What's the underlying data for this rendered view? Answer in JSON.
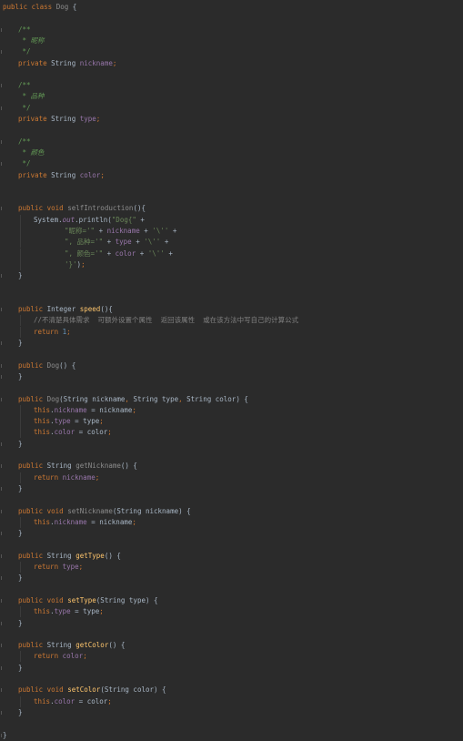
{
  "editor": {
    "language": "Java",
    "colors": {
      "background": "#2b2b2b",
      "keyword": "#cc7832",
      "plain": "#a9b7c6",
      "field": "#9876aa",
      "method": "#ffc66d",
      "string": "#6a8759",
      "number": "#6897bb",
      "doc": "#629755",
      "comment": "#808080",
      "unused": "#8c8c8c"
    },
    "lines": [
      {
        "row": 0,
        "indent": 0,
        "fold": false,
        "tokens": [
          [
            "kw",
            "public class "
          ],
          [
            "unused",
            "Dog "
          ],
          [
            "plain",
            "{"
          ]
        ]
      },
      {
        "row": 2,
        "indent": 1,
        "fold": true,
        "tokens": [
          [
            "doc",
            "/**"
          ]
        ]
      },
      {
        "row": 3,
        "indent": 1,
        "fold": false,
        "tokens": [
          [
            "doc",
            " * "
          ],
          [
            "doc-text",
            "昵称"
          ]
        ]
      },
      {
        "row": 4,
        "indent": 1,
        "fold": true,
        "tokens": [
          [
            "doc",
            " */"
          ]
        ]
      },
      {
        "row": 5,
        "indent": 1,
        "fold": false,
        "tokens": [
          [
            "kw",
            "private "
          ],
          [
            "plain",
            "String "
          ],
          [
            "field",
            "nickname"
          ],
          [
            "kw",
            ";"
          ]
        ]
      },
      {
        "row": 7,
        "indent": 1,
        "fold": true,
        "tokens": [
          [
            "doc",
            "/**"
          ]
        ]
      },
      {
        "row": 8,
        "indent": 1,
        "fold": false,
        "tokens": [
          [
            "doc",
            " * "
          ],
          [
            "doc-text",
            "品种"
          ]
        ]
      },
      {
        "row": 9,
        "indent": 1,
        "fold": true,
        "tokens": [
          [
            "doc",
            " */"
          ]
        ]
      },
      {
        "row": 10,
        "indent": 1,
        "fold": false,
        "tokens": [
          [
            "kw",
            "private "
          ],
          [
            "plain",
            "String "
          ],
          [
            "field",
            "type"
          ],
          [
            "kw",
            ";"
          ]
        ]
      },
      {
        "row": 12,
        "indent": 1,
        "fold": true,
        "tokens": [
          [
            "doc",
            "/**"
          ]
        ]
      },
      {
        "row": 13,
        "indent": 1,
        "fold": false,
        "tokens": [
          [
            "doc",
            " * "
          ],
          [
            "doc-text",
            "颜色"
          ]
        ]
      },
      {
        "row": 14,
        "indent": 1,
        "fold": true,
        "tokens": [
          [
            "doc",
            " */"
          ]
        ]
      },
      {
        "row": 15,
        "indent": 1,
        "fold": false,
        "tokens": [
          [
            "kw",
            "private "
          ],
          [
            "plain",
            "String "
          ],
          [
            "field",
            "color"
          ],
          [
            "kw",
            ";"
          ]
        ]
      },
      {
        "row": 18,
        "indent": 1,
        "fold": true,
        "tokens": [
          [
            "kw",
            "public void "
          ],
          [
            "unused",
            "selfIntroduction"
          ],
          [
            "plain",
            "(){"
          ]
        ]
      },
      {
        "row": 19,
        "indent": 2,
        "fold": false,
        "tokens": [
          [
            "plain",
            "System."
          ],
          [
            "static",
            "out"
          ],
          [
            "plain",
            ".println("
          ],
          [
            "string",
            "\"Dog{\" "
          ],
          [
            "plain",
            "+"
          ]
        ]
      },
      {
        "row": 20,
        "indent": 4,
        "fold": false,
        "tokens": [
          [
            "string",
            "\"昵称='\" "
          ],
          [
            "plain",
            "+ "
          ],
          [
            "field",
            "nickname "
          ],
          [
            "plain",
            "+ "
          ],
          [
            "string",
            "'\\'' "
          ],
          [
            "plain",
            "+"
          ]
        ]
      },
      {
        "row": 21,
        "indent": 4,
        "fold": false,
        "tokens": [
          [
            "string",
            "\", 品种='\" "
          ],
          [
            "plain",
            "+ "
          ],
          [
            "field",
            "type "
          ],
          [
            "plain",
            "+ "
          ],
          [
            "string",
            "'\\'' "
          ],
          [
            "plain",
            "+"
          ]
        ]
      },
      {
        "row": 22,
        "indent": 4,
        "fold": false,
        "tokens": [
          [
            "string",
            "\", 颜色='\" "
          ],
          [
            "plain",
            "+ "
          ],
          [
            "field",
            "color "
          ],
          [
            "plain",
            "+ "
          ],
          [
            "string",
            "'\\'' "
          ],
          [
            "plain",
            "+"
          ]
        ]
      },
      {
        "row": 23,
        "indent": 4,
        "fold": false,
        "tokens": [
          [
            "string",
            "'}'"
          ],
          [
            "plain",
            ")"
          ],
          [
            "kw",
            ";"
          ]
        ]
      },
      {
        "row": 24,
        "indent": 1,
        "fold": true,
        "tokens": [
          [
            "plain",
            "}"
          ]
        ]
      },
      {
        "row": 27,
        "indent": 1,
        "fold": true,
        "tokens": [
          [
            "kw",
            "public "
          ],
          [
            "plain",
            "Integer "
          ],
          [
            "method",
            "speed"
          ],
          [
            "plain",
            "(){"
          ]
        ]
      },
      {
        "row": 28,
        "indent": 2,
        "fold": false,
        "tokens": [
          [
            "comment",
            "//不清楚具体需求  可额外设置个属性  返回该属性  或在该方法中写自己的计算公式"
          ]
        ]
      },
      {
        "row": 29,
        "indent": 2,
        "fold": false,
        "tokens": [
          [
            "kw",
            "return "
          ],
          [
            "number",
            "1"
          ],
          [
            "kw",
            ";"
          ]
        ]
      },
      {
        "row": 30,
        "indent": 1,
        "fold": true,
        "tokens": [
          [
            "plain",
            "}"
          ]
        ]
      },
      {
        "row": 32,
        "indent": 1,
        "fold": true,
        "tokens": [
          [
            "kw",
            "public "
          ],
          [
            "unused",
            "Dog"
          ],
          [
            "plain",
            "() {"
          ]
        ]
      },
      {
        "row": 33,
        "indent": 1,
        "fold": true,
        "tokens": [
          [
            "plain",
            "}"
          ]
        ]
      },
      {
        "row": 35,
        "indent": 1,
        "fold": true,
        "tokens": [
          [
            "kw",
            "public "
          ],
          [
            "unused",
            "Dog"
          ],
          [
            "plain",
            "(String nickname"
          ],
          [
            "kw",
            ", "
          ],
          [
            "plain",
            "String type"
          ],
          [
            "kw",
            ", "
          ],
          [
            "plain",
            "String color) {"
          ]
        ]
      },
      {
        "row": 36,
        "indent": 2,
        "fold": false,
        "tokens": [
          [
            "kw",
            "this"
          ],
          [
            "plain",
            "."
          ],
          [
            "field",
            "nickname "
          ],
          [
            "plain",
            "= nickname"
          ],
          [
            "kw",
            ";"
          ]
        ]
      },
      {
        "row": 37,
        "indent": 2,
        "fold": false,
        "tokens": [
          [
            "kw",
            "this"
          ],
          [
            "plain",
            "."
          ],
          [
            "field",
            "type "
          ],
          [
            "plain",
            "= type"
          ],
          [
            "kw",
            ";"
          ]
        ]
      },
      {
        "row": 38,
        "indent": 2,
        "fold": false,
        "tokens": [
          [
            "kw",
            "this"
          ],
          [
            "plain",
            "."
          ],
          [
            "field",
            "color "
          ],
          [
            "plain",
            "= color"
          ],
          [
            "kw",
            ";"
          ]
        ]
      },
      {
        "row": 39,
        "indent": 1,
        "fold": true,
        "tokens": [
          [
            "plain",
            "}"
          ]
        ]
      },
      {
        "row": 41,
        "indent": 1,
        "fold": true,
        "tokens": [
          [
            "kw",
            "public "
          ],
          [
            "plain",
            "String "
          ],
          [
            "unused",
            "getNickname"
          ],
          [
            "plain",
            "() {"
          ]
        ]
      },
      {
        "row": 42,
        "indent": 2,
        "fold": false,
        "tokens": [
          [
            "kw",
            "return "
          ],
          [
            "field",
            "nickname"
          ],
          [
            "kw",
            ";"
          ]
        ]
      },
      {
        "row": 43,
        "indent": 1,
        "fold": true,
        "tokens": [
          [
            "plain",
            "}"
          ]
        ]
      },
      {
        "row": 45,
        "indent": 1,
        "fold": true,
        "tokens": [
          [
            "kw",
            "public void "
          ],
          [
            "unused",
            "setNickname"
          ],
          [
            "plain",
            "(String nickname) {"
          ]
        ]
      },
      {
        "row": 46,
        "indent": 2,
        "fold": false,
        "tokens": [
          [
            "kw",
            "this"
          ],
          [
            "plain",
            "."
          ],
          [
            "field",
            "nickname "
          ],
          [
            "plain",
            "= nickname"
          ],
          [
            "kw",
            ";"
          ]
        ]
      },
      {
        "row": 47,
        "indent": 1,
        "fold": true,
        "tokens": [
          [
            "plain",
            "}"
          ]
        ]
      },
      {
        "row": 49,
        "indent": 1,
        "fold": true,
        "tokens": [
          [
            "kw",
            "public "
          ],
          [
            "plain",
            "String "
          ],
          [
            "method",
            "getType"
          ],
          [
            "plain",
            "() {"
          ]
        ]
      },
      {
        "row": 50,
        "indent": 2,
        "fold": false,
        "tokens": [
          [
            "kw",
            "return "
          ],
          [
            "field",
            "type"
          ],
          [
            "kw",
            ";"
          ]
        ]
      },
      {
        "row": 51,
        "indent": 1,
        "fold": true,
        "tokens": [
          [
            "plain",
            "}"
          ]
        ]
      },
      {
        "row": 53,
        "indent": 1,
        "fold": true,
        "tokens": [
          [
            "kw",
            "public void "
          ],
          [
            "method",
            "setType"
          ],
          [
            "plain",
            "(String type) {"
          ]
        ]
      },
      {
        "row": 54,
        "indent": 2,
        "fold": false,
        "tokens": [
          [
            "kw",
            "this"
          ],
          [
            "plain",
            "."
          ],
          [
            "field",
            "type "
          ],
          [
            "plain",
            "= type"
          ],
          [
            "kw",
            ";"
          ]
        ]
      },
      {
        "row": 55,
        "indent": 1,
        "fold": true,
        "tokens": [
          [
            "plain",
            "}"
          ]
        ]
      },
      {
        "row": 57,
        "indent": 1,
        "fold": true,
        "tokens": [
          [
            "kw",
            "public "
          ],
          [
            "plain",
            "String "
          ],
          [
            "method",
            "getColor"
          ],
          [
            "plain",
            "() {"
          ]
        ]
      },
      {
        "row": 58,
        "indent": 2,
        "fold": false,
        "tokens": [
          [
            "kw",
            "return "
          ],
          [
            "field",
            "color"
          ],
          [
            "kw",
            ";"
          ]
        ]
      },
      {
        "row": 59,
        "indent": 1,
        "fold": true,
        "tokens": [
          [
            "plain",
            "}"
          ]
        ]
      },
      {
        "row": 61,
        "indent": 1,
        "fold": true,
        "tokens": [
          [
            "kw",
            "public void "
          ],
          [
            "method",
            "setColor"
          ],
          [
            "plain",
            "(String color) {"
          ]
        ]
      },
      {
        "row": 62,
        "indent": 2,
        "fold": false,
        "tokens": [
          [
            "kw",
            "this"
          ],
          [
            "plain",
            "."
          ],
          [
            "field",
            "color "
          ],
          [
            "plain",
            "= color"
          ],
          [
            "kw",
            ";"
          ]
        ]
      },
      {
        "row": 63,
        "indent": 1,
        "fold": true,
        "tokens": [
          [
            "plain",
            "}"
          ]
        ]
      },
      {
        "row": 65,
        "indent": 0,
        "fold": true,
        "tokens": [
          [
            "plain",
            "}"
          ]
        ]
      }
    ]
  }
}
